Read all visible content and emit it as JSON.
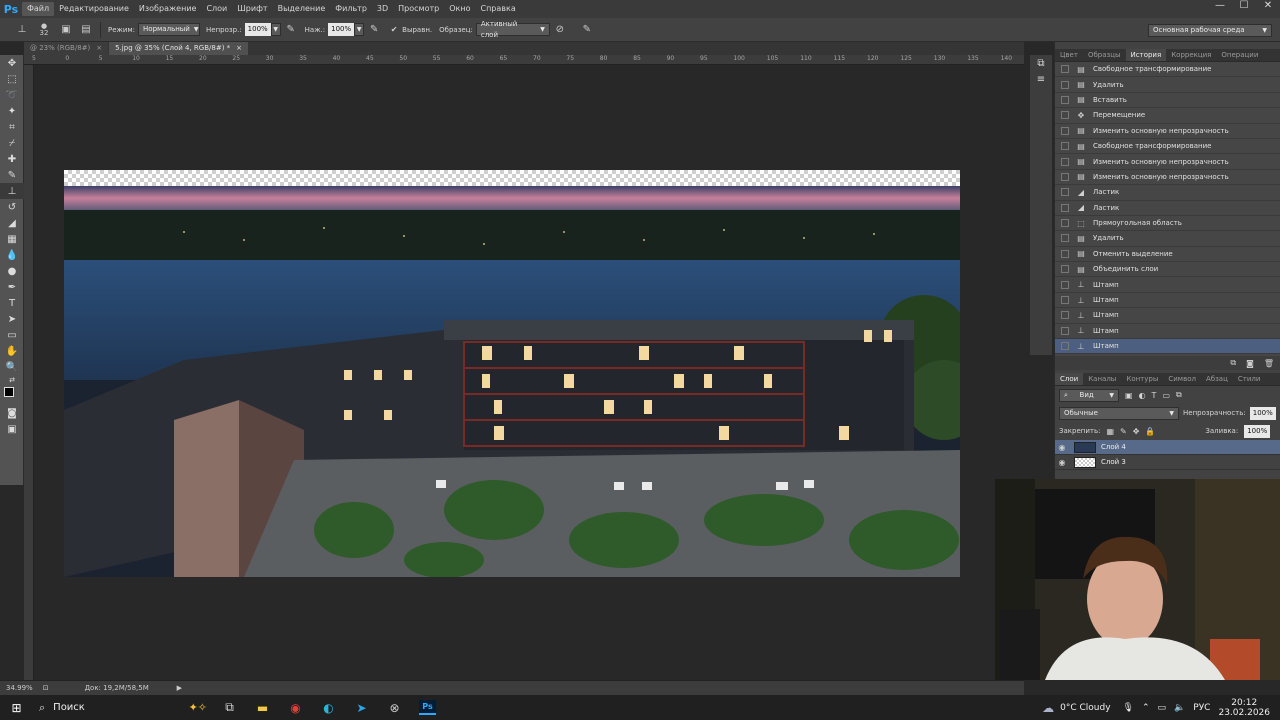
{
  "app": {
    "logo": "Ps"
  },
  "menu": [
    "Файл",
    "Редактирование",
    "Изображение",
    "Слои",
    "Шрифт",
    "Выделение",
    "Фильтр",
    "3D",
    "Просмотр",
    "Окно",
    "Справка"
  ],
  "window_controls": {
    "minimize": "—",
    "maximize": "☐",
    "close": "✕"
  },
  "options": {
    "brush_size": "32",
    "mode_label": "Режим:",
    "mode_value": "Нормальный",
    "opacity_label": "Непрозр.:",
    "opacity_value": "100%",
    "flow_label": "Наж.:",
    "flow_value": "100%",
    "aligned_label": "Выравн.",
    "sample_label": "Образец:",
    "sample_value": "Активный слой"
  },
  "workspace": "Основная рабочая среда",
  "tabs": [
    {
      "label": "@ 23% (RGB/8#)",
      "close": "×"
    },
    {
      "label": "5.jpg @ 35% (Слой 4, RGB/8#) *",
      "close": "×"
    }
  ],
  "ruler_ticks": [
    "5",
    "0",
    "5",
    "10",
    "15",
    "20",
    "25",
    "30",
    "35",
    "40",
    "45",
    "50",
    "55",
    "60",
    "65",
    "70",
    "75",
    "80",
    "85",
    "90",
    "95",
    "100",
    "105",
    "110",
    "115",
    "120",
    "125",
    "130",
    "135",
    "140"
  ],
  "status": {
    "zoom": "34.99%",
    "doc": "Док: 19,2M/58,5M",
    "arrow": "▶"
  },
  "panels": {
    "top_tabs": [
      "Цвет",
      "Образцы",
      "История",
      "Коррекция",
      "Операции"
    ],
    "top_active": 2,
    "history": [
      {
        "icon": "doc-icon",
        "glyph": "▤",
        "label": "Свободное трансформирование"
      },
      {
        "icon": "doc-icon",
        "glyph": "▤",
        "label": "Удалить"
      },
      {
        "icon": "doc-icon",
        "glyph": "▤",
        "label": "Вставить"
      },
      {
        "icon": "move-icon",
        "glyph": "✥",
        "label": "Перемещение"
      },
      {
        "icon": "doc-icon",
        "glyph": "▤",
        "label": "Изменить основную непрозрачность"
      },
      {
        "icon": "doc-icon",
        "glyph": "▤",
        "label": "Свободное трансформирование"
      },
      {
        "icon": "doc-icon",
        "glyph": "▤",
        "label": "Изменить основную непрозрачность"
      },
      {
        "icon": "doc-icon",
        "glyph": "▤",
        "label": "Изменить основную непрозрачность"
      },
      {
        "icon": "eraser-icon",
        "glyph": "◢",
        "label": "Ластик"
      },
      {
        "icon": "eraser-icon",
        "glyph": "◢",
        "label": "Ластик"
      },
      {
        "icon": "marquee-icon",
        "glyph": "⬚",
        "label": "Прямоугольная область"
      },
      {
        "icon": "doc-icon",
        "glyph": "▤",
        "label": "Удалить"
      },
      {
        "icon": "doc-icon",
        "glyph": "▤",
        "label": "Отменить выделение"
      },
      {
        "icon": "doc-icon",
        "glyph": "▤",
        "label": "Объединить слои"
      },
      {
        "icon": "stamp-icon",
        "glyph": "⊥",
        "label": "Штамп"
      },
      {
        "icon": "stamp-icon",
        "glyph": "⊥",
        "label": "Штамп"
      },
      {
        "icon": "stamp-icon",
        "glyph": "⊥",
        "label": "Штамп"
      },
      {
        "icon": "stamp-icon",
        "glyph": "⊥",
        "label": "Штамп"
      },
      {
        "icon": "stamp-icon",
        "glyph": "⊥",
        "label": "Штамп"
      }
    ],
    "layer_tabs": [
      "Слои",
      "Каналы",
      "Контуры",
      "Символ",
      "Абзац",
      "Стили"
    ],
    "layer_active": 0,
    "filter_label": "Вид",
    "blend_mode": "Обычные",
    "opacity_label": "Непрозрачность:",
    "opacity_value": "100%",
    "lock_label": "Закрепить:",
    "fill_label": "Заливка:",
    "fill_value": "100%",
    "layers": [
      {
        "name": "Слой 4",
        "selected": true
      },
      {
        "name": "Слой 3",
        "selected": false
      }
    ]
  },
  "taskbar": {
    "search": "Поиск",
    "weather": "0°C  Cloudy",
    "lang": "РУС",
    "time": "20:12",
    "date": "23.02.2026"
  }
}
